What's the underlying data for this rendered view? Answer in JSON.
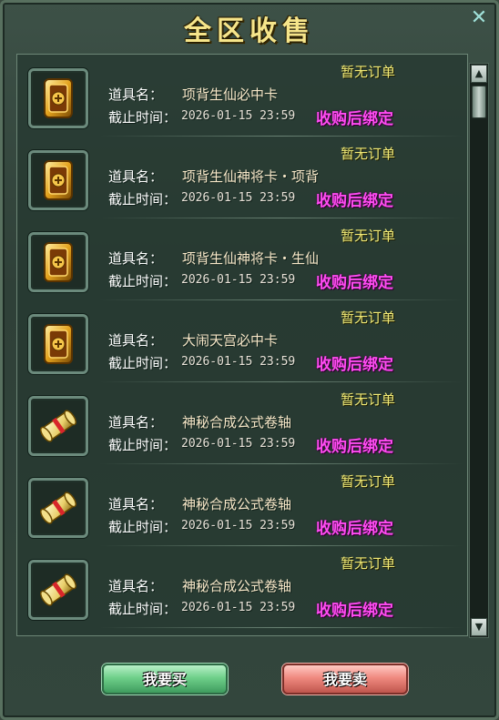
{
  "window": {
    "title": "全区收售",
    "close_icon": "close-icon"
  },
  "colors": {
    "title": "#f6e58a",
    "status": "#f3ec77",
    "bind_note": "#ff4cf2",
    "buy_button": "#6fd08a",
    "sell_button": "#f08a80"
  },
  "list": {
    "name_label": "道具名：",
    "time_label": "截止时间：",
    "items": [
      {
        "icon": "gold-card-icon",
        "status": "暂无订单",
        "name": "项背生仙必中卡",
        "deadline": "2026-01-15 23:59",
        "bind_note": "收购后绑定"
      },
      {
        "icon": "gold-card-icon",
        "status": "暂无订单",
        "name": "项背生仙神将卡・项背",
        "deadline": "2026-01-15 23:59",
        "bind_note": "收购后绑定"
      },
      {
        "icon": "gold-card-icon",
        "status": "暂无订单",
        "name": "项背生仙神将卡・生仙",
        "deadline": "2026-01-15 23:59",
        "bind_note": "收购后绑定"
      },
      {
        "icon": "gold-card-icon",
        "status": "暂无订单",
        "name": "大闹天宫必中卡",
        "deadline": "2026-01-15 23:59",
        "bind_note": "收购后绑定"
      },
      {
        "icon": "scroll-icon",
        "status": "暂无订单",
        "name": "神秘合成公式卷轴",
        "deadline": "2026-01-15 23:59",
        "bind_note": "收购后绑定"
      },
      {
        "icon": "scroll-icon",
        "status": "暂无订单",
        "name": "神秘合成公式卷轴",
        "deadline": "2026-01-15 23:59",
        "bind_note": "收购后绑定"
      },
      {
        "icon": "scroll-icon",
        "status": "暂无订单",
        "name": "神秘合成公式卷轴",
        "deadline": "2026-01-15 23:59",
        "bind_note": "收购后绑定"
      }
    ]
  },
  "scrollbar": {
    "up_icon": "scroll-up-arrow-icon",
    "down_icon": "scroll-down-arrow-icon"
  },
  "buttons": {
    "buy": "我要买",
    "sell": "我要卖"
  }
}
